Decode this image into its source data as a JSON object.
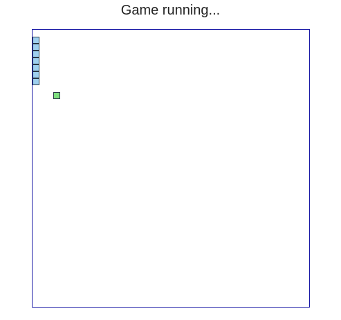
{
  "status": {
    "text": "Game running..."
  },
  "board": {
    "cols": 40,
    "rows": 40,
    "border_color": "#1a1aa6",
    "background": "#ffffff"
  },
  "snake": {
    "color": "#9fd0ef",
    "border_color": "#2b3a48",
    "segments": [
      {
        "col": 0,
        "row": 1
      },
      {
        "col": 0,
        "row": 2
      },
      {
        "col": 0,
        "row": 3
      },
      {
        "col": 0,
        "row": 4
      },
      {
        "col": 0,
        "row": 5
      },
      {
        "col": 0,
        "row": 6
      },
      {
        "col": 0,
        "row": 7
      }
    ]
  },
  "food": {
    "color": "#7fe07f",
    "border_color": "#2b3a48",
    "col": 3,
    "row": 9
  }
}
